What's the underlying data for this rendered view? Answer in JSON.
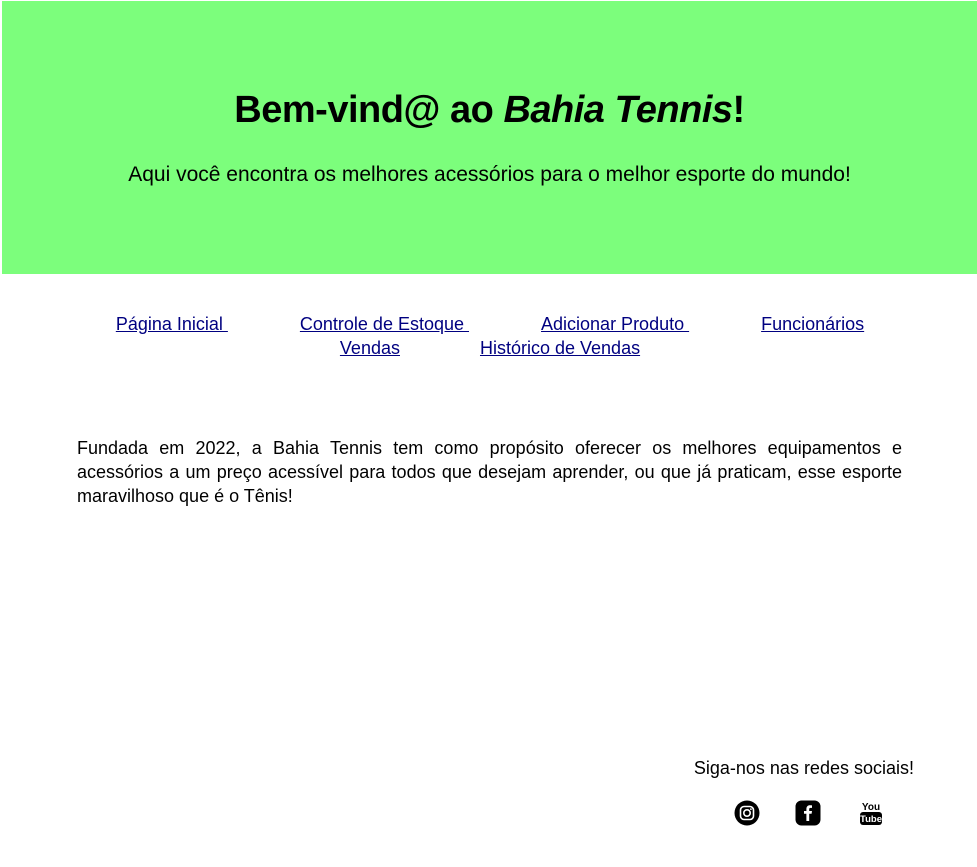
{
  "header": {
    "title_prefix": "Bem-vind@ ao ",
    "title_brand": "Bahia Tennis",
    "title_suffix": "!",
    "subtitle": "Aqui você encontra os melhores acessórios para o melhor esporte do mundo!",
    "background_color": "#7cfe7c"
  },
  "nav": {
    "link_color": "#000080",
    "items": [
      {
        "label": "Página Inicial "
      },
      {
        "label": "Controle de Estoque "
      },
      {
        "label": "Adicionar Produto "
      },
      {
        "label": "Funcionários"
      },
      {
        "label": "Vendas"
      },
      {
        "label": "Histórico de Vendas"
      }
    ]
  },
  "about": {
    "text": "Fundada em 2022, a Bahia Tennis tem como propósito oferecer os melhores equipamentos e acessórios a um preço acessível para todos que desejam aprender, ou que já praticam, esse esporte maravilhoso que é o Tênis!"
  },
  "footer": {
    "social_label": "Siga-nos nas redes sociais!",
    "icons": [
      "instagram-icon",
      "facebook-icon",
      "youtube-icon"
    ]
  }
}
